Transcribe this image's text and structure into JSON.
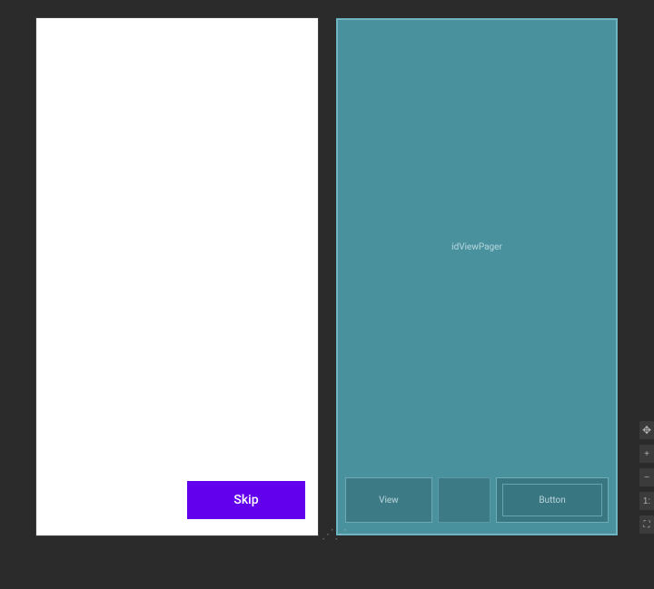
{
  "designPreview": {
    "skipButton": {
      "label": "Skip"
    }
  },
  "blueprint": {
    "viewPager": {
      "label": "idViewPager"
    },
    "bottomBar": {
      "viewLabel": "View",
      "buttonLabel": "Button"
    }
  },
  "toolbar": {
    "pan": "✥",
    "zoomIn": "+",
    "zoomOut": "−",
    "scale": "1:",
    "fit": "⛶"
  },
  "colors": {
    "accent": "#6200ee",
    "blueprint": "#4a919e",
    "canvasBg": "#2b2b2b"
  }
}
